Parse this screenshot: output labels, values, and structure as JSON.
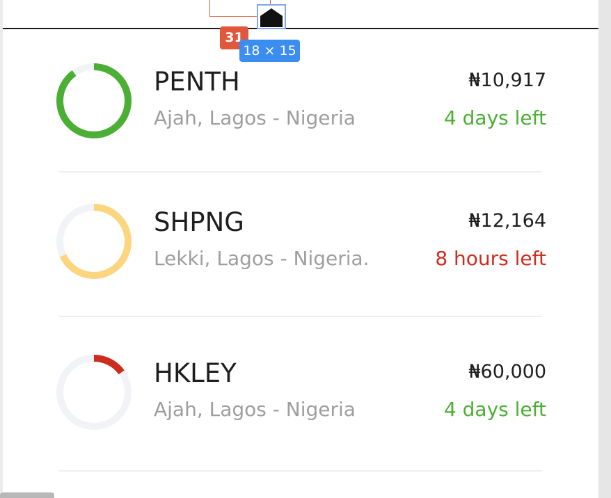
{
  "overlay": {
    "badge_number": "31",
    "dimensions": "18 × 15"
  },
  "colors": {
    "green": "#4caf35",
    "yellow": "#fbd67e",
    "red": "#cd2d1f",
    "ring_track": "#f2f3f6"
  },
  "items": [
    {
      "name": "PENTH",
      "location": "Ajah, Lagos - Nigeria",
      "price": "₦10,917",
      "time_left": "4 days left",
      "time_color": "#4caf35",
      "ring_color": "#4caf35",
      "progress": 0.9
    },
    {
      "name": "SHPNG",
      "location": "Lekki, Lagos - Nigeria.",
      "price": "₦12,164",
      "time_left": "8 hours left",
      "time_color": "#cd2d1f",
      "ring_color": "#fbd67e",
      "progress": 0.68
    },
    {
      "name": "HKLEY",
      "location": "Ajah, Lagos - Nigeria",
      "price": "₦60,000",
      "time_left": "4 days left",
      "time_color": "#4caf35",
      "ring_color": "#cd2d1f",
      "progress": 0.15
    }
  ]
}
